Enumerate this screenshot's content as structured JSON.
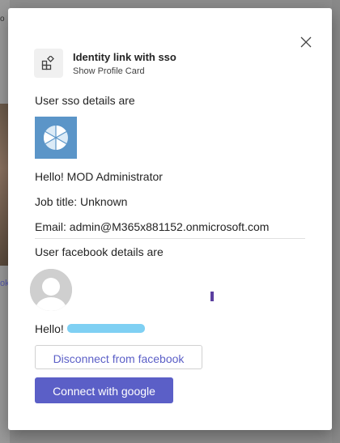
{
  "background": {
    "fragment_top": "o",
    "fragment_mid": "ok"
  },
  "dialog": {
    "app_name": "Identity link with sso",
    "app_subtitle": "Show Profile Card",
    "sso_heading": "User sso details are",
    "greeting": "Hello! MOD Administrator",
    "job_title": "Job title: Unknown",
    "email": "Email: admin@M365x881152.onmicrosoft.com",
    "facebook_heading": "User facebook details are",
    "facebook_greeting": "Hello!",
    "disconnect_label": "Disconnect from facebook",
    "connect_google_label": "Connect with google"
  },
  "colors": {
    "accent": "#5b5fc7",
    "sso_avatar_bg": "#5b95c8",
    "redaction": "#7fd0f3"
  },
  "icons": {
    "close": "close-icon",
    "app": "app-grid-icon",
    "sso_avatar": "pie-logo-icon",
    "facebook_avatar": "default-person-icon"
  }
}
